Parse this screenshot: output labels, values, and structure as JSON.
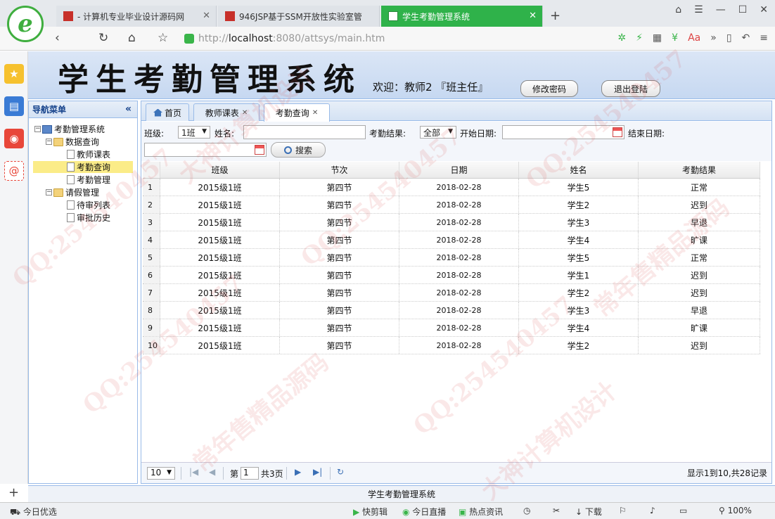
{
  "browser": {
    "tabs": [
      {
        "label": "- 计算机专业毕业设计源码网"
      },
      {
        "label": "946JSP基于SSM开放性实验室管"
      },
      {
        "label": "学生考勤管理系统"
      }
    ],
    "url_scheme": "http://",
    "url_host": "localhost",
    "url_rest": ":8080/attsys/main.htm",
    "status_left": "今日优选",
    "status_items": [
      "快剪辑",
      "今日直播",
      "热点资讯",
      "下载",
      "100%"
    ]
  },
  "header": {
    "title": "学生考勤管理系统",
    "welcome": "欢迎：教师2 『班主任』",
    "change_password": "修改密码",
    "logout": "退出登陆"
  },
  "nav": {
    "title": "导航菜单",
    "collapse_glyph": "«",
    "root": "考勤管理系统",
    "group1": "数据查询",
    "item1": "教师课表",
    "item2": "考勤查询",
    "item3": "考勤管理",
    "group2": "请假管理",
    "item4": "待审列表",
    "item5": "审批历史"
  },
  "tabs": {
    "home": "首页",
    "schedule": "教师课表",
    "query": "考勤查询"
  },
  "filters": {
    "class_label": "班级:",
    "class_value": "1班",
    "name_label": "姓名:",
    "result_label": "考勤结果:",
    "result_value": "全部",
    "start_label": "开始日期:",
    "end_label": "结束日期:",
    "search": "搜索"
  },
  "grid": {
    "columns": [
      "班级",
      "节次",
      "日期",
      "姓名",
      "考勤结果"
    ],
    "rows": [
      [
        "1",
        "2015级1班",
        "第四节",
        "2018-02-28",
        "学生5",
        "正常"
      ],
      [
        "2",
        "2015级1班",
        "第四节",
        "2018-02-28",
        "学生2",
        "迟到"
      ],
      [
        "3",
        "2015级1班",
        "第四节",
        "2018-02-28",
        "学生3",
        "早退"
      ],
      [
        "4",
        "2015级1班",
        "第四节",
        "2018-02-28",
        "学生4",
        "旷课"
      ],
      [
        "5",
        "2015级1班",
        "第四节",
        "2018-02-28",
        "学生5",
        "正常"
      ],
      [
        "6",
        "2015级1班",
        "第四节",
        "2018-02-28",
        "学生1",
        "迟到"
      ],
      [
        "7",
        "2015级1班",
        "第四节",
        "2018-02-28",
        "学生2",
        "迟到"
      ],
      [
        "8",
        "2015级1班",
        "第四节",
        "2018-02-28",
        "学生3",
        "早退"
      ],
      [
        "9",
        "2015级1班",
        "第四节",
        "2018-02-28",
        "学生4",
        "旷课"
      ],
      [
        "10",
        "2015级1班",
        "第四节",
        "2018-02-28",
        "学生2",
        "迟到"
      ]
    ]
  },
  "pager": {
    "page_size": "10",
    "page_prefix": "第",
    "page_value": "1",
    "page_total": "共3页",
    "summary": "显示1到10,共28记录"
  },
  "footer": "学生考勤管理系统",
  "watermarks": [
    "QQ:254540457",
    "常年售精品源码",
    "大神计算机设计"
  ]
}
